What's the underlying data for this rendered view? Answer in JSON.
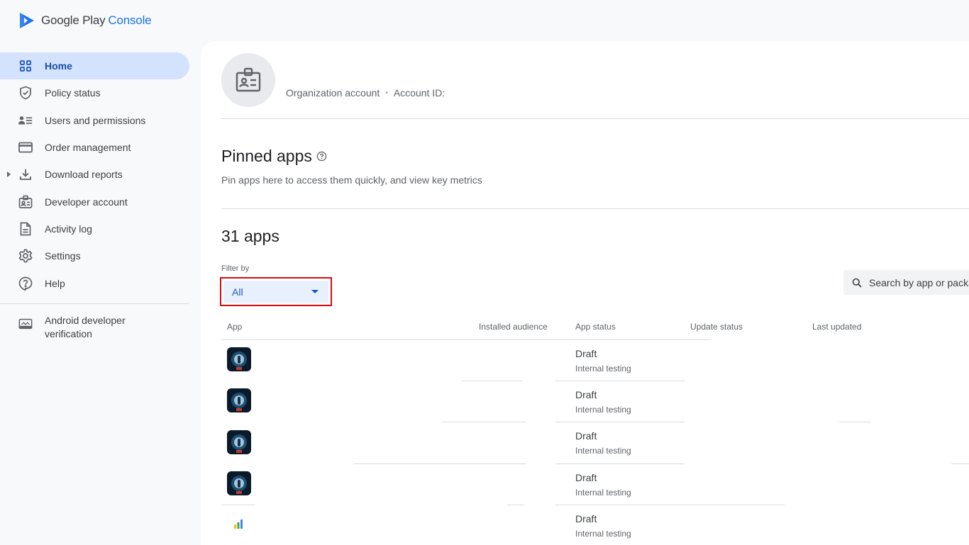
{
  "brand": {
    "google": "Google Play",
    "console": "Console"
  },
  "sidebar": {
    "items": [
      {
        "label": "Home",
        "icon": "grid-icon",
        "active": true
      },
      {
        "label": "Policy status",
        "icon": "shield-icon"
      },
      {
        "label": "Users and permissions",
        "icon": "users-icon"
      },
      {
        "label": "Order management",
        "icon": "card-icon"
      },
      {
        "label": "Download reports",
        "icon": "download-icon",
        "expandable": true
      },
      {
        "label": "Developer account",
        "icon": "badge-icon"
      },
      {
        "label": "Activity log",
        "icon": "document-icon"
      },
      {
        "label": "Settings",
        "icon": "gear-icon"
      },
      {
        "label": "Help",
        "icon": "help-icon"
      }
    ],
    "verification": {
      "line1": "Android developer",
      "line2": "verification",
      "icon": "verification-icon"
    }
  },
  "account": {
    "type": "Organization account",
    "id_label": "Account ID:"
  },
  "pinned": {
    "title": "Pinned apps",
    "subtitle": "Pin apps here to access them quickly, and view key metrics"
  },
  "apps": {
    "count_title": "31 apps",
    "filter_label": "Filter by",
    "filter_value": "All",
    "search_placeholder": "Search by app or package name",
    "columns": [
      "App",
      "Installed audience",
      "App status",
      "Update status",
      "Last updated"
    ],
    "rows": [
      {
        "status": "Draft",
        "track": "Internal testing",
        "icon": "app-icon-robot"
      },
      {
        "status": "Draft",
        "track": "Internal testing",
        "icon": "app-icon-robot"
      },
      {
        "status": "Draft",
        "track": "Internal testing",
        "icon": "app-icon-robot"
      },
      {
        "status": "Draft",
        "track": "Internal testing",
        "icon": "app-icon-robot"
      },
      {
        "status": "Draft",
        "track": "Internal testing",
        "icon": "app-icon-bars"
      }
    ]
  },
  "colors": {
    "accent": "#1a73e8",
    "active_nav_bg": "#d3e3fd",
    "highlight_border": "#e0080f"
  }
}
